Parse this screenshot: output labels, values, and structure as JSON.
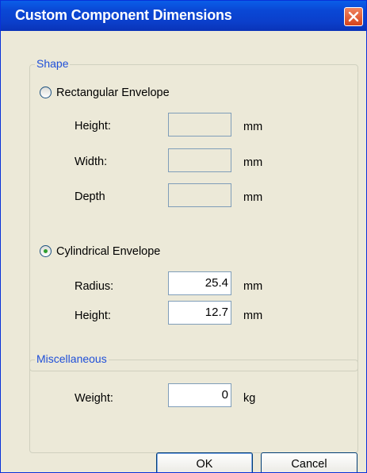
{
  "window": {
    "title": "Custom Component Dimensions"
  },
  "shape": {
    "legend": "Shape",
    "rectangular": {
      "label": "Rectangular Envelope",
      "selected": false,
      "fields": [
        {
          "label": "Height:",
          "value": "",
          "unit": "mm",
          "enabled": false
        },
        {
          "label": "Width:",
          "value": "",
          "unit": "mm",
          "enabled": false
        },
        {
          "label": "Depth",
          "value": "",
          "unit": "mm",
          "enabled": false
        }
      ]
    },
    "cylindrical": {
      "label": "Cylindrical Envelope",
      "selected": true,
      "fields": [
        {
          "label": "Radius:",
          "value": "25.4",
          "unit": "mm",
          "enabled": true
        },
        {
          "label": "Height:",
          "value": "12.7",
          "unit": "mm",
          "enabled": true
        }
      ]
    }
  },
  "misc": {
    "legend": "Miscellaneous",
    "weight": {
      "label": "Weight:",
      "value": "0",
      "unit": "kg"
    }
  },
  "buttons": {
    "ok": "OK",
    "cancel": "Cancel"
  },
  "colors": {
    "titlebar": "#0a48d6",
    "legend_text": "#1f4fd8",
    "dialog_bg": "#ece9d8",
    "radio_selected": "#2f9e2f"
  },
  "icons": {
    "close": "close-icon"
  }
}
